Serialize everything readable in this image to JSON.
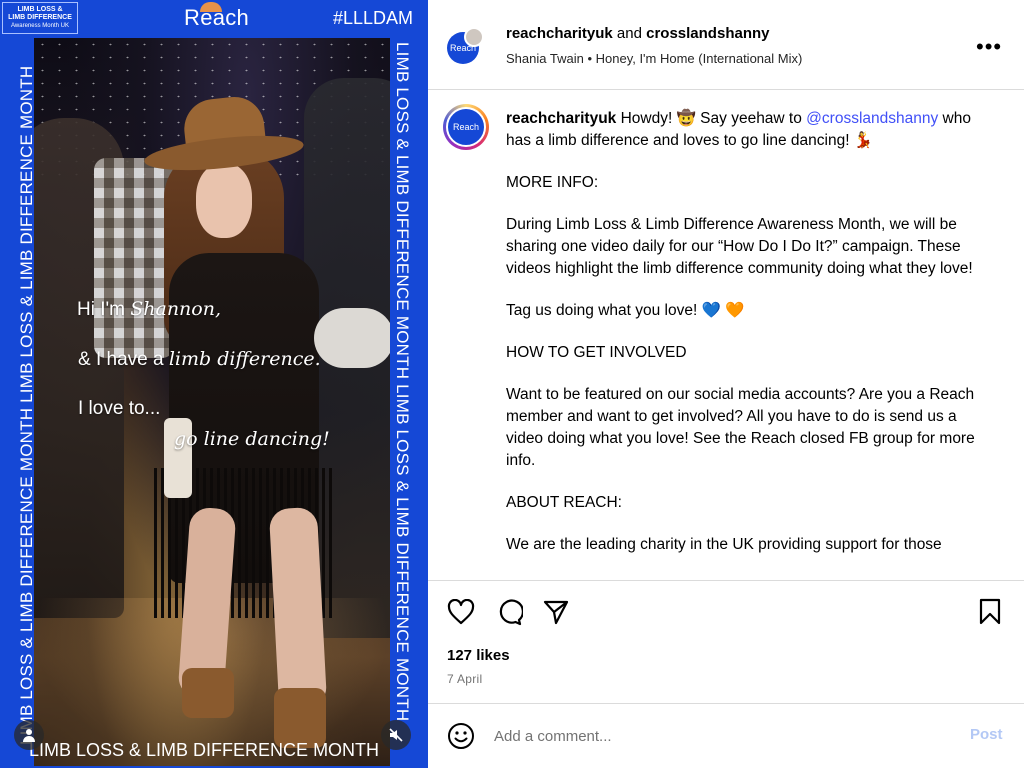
{
  "media": {
    "badge_line1": "LIMB LOSS &",
    "badge_line2": "LIMB DIFFERENCE",
    "badge_line3": "Awareness Month UK",
    "logo_text": "Reach",
    "hashtag": "#LLLDAM",
    "side_text": "LIMB LOSS & LIMB DIFFERENCE MONTH LIMB LOSS & LIMB DIFFERENCE MONTH",
    "bottom_text": "LIMB LOSS & LIMB DIFFERENCE MONTH",
    "overlay": {
      "line1_a": "Hi I'm ",
      "line1_b": "Shannon,",
      "line2_a": "& I have a ",
      "line2_b": "limb difference.",
      "line3": "I love to...",
      "line4": "go line dancing!"
    },
    "user_icon": "person-icon",
    "mute_icon": "muted-speaker-icon",
    "accent_color": "#1548d6"
  },
  "header": {
    "avatar_text": "Reach",
    "user1": "reachcharityuk",
    "connector": " and ",
    "user2": "crosslandshanny",
    "artist": "Shania Twain",
    "separator": " • ",
    "song": "Honey, I'm Home (International Mix)",
    "more_icon": "more-options-icon"
  },
  "caption": {
    "avatar_text": "Reach",
    "username": "reachcharityuk",
    "intro_a": " Howdy! 🤠 Say yeehaw to ",
    "mention": "@crosslandshanny",
    "intro_b": " who has a limb difference and loves to go line dancing! 💃",
    "more_info_heading": "MORE INFO:",
    "para1": "During Limb Loss & Limb Difference Awareness Month, we will be sharing one video daily for our “How Do I Do It?” campaign. These videos highlight the limb difference community doing what they love!",
    "para2": "Tag us doing what you love! 💙 🧡",
    "how_heading": "HOW TO GET INVOLVED",
    "para3": "Want to be featured on our social media accounts? Are you a Reach member and want to get involved? All you have to do is send us a video doing what you love! See the Reach closed FB group for more info.",
    "about_heading": "ABOUT REACH:",
    "para4": "We are the leading charity in the UK providing support for those"
  },
  "actions": {
    "like_icon": "heart-icon",
    "comment_icon": "comment-icon",
    "share_icon": "share-icon",
    "save_icon": "bookmark-icon",
    "likes": "127 likes",
    "date": "7 April"
  },
  "comment_box": {
    "emoji_icon": "emoji-icon",
    "placeholder": "Add a comment...",
    "post_label": "Post",
    "post_color": "#b3c8f5"
  }
}
